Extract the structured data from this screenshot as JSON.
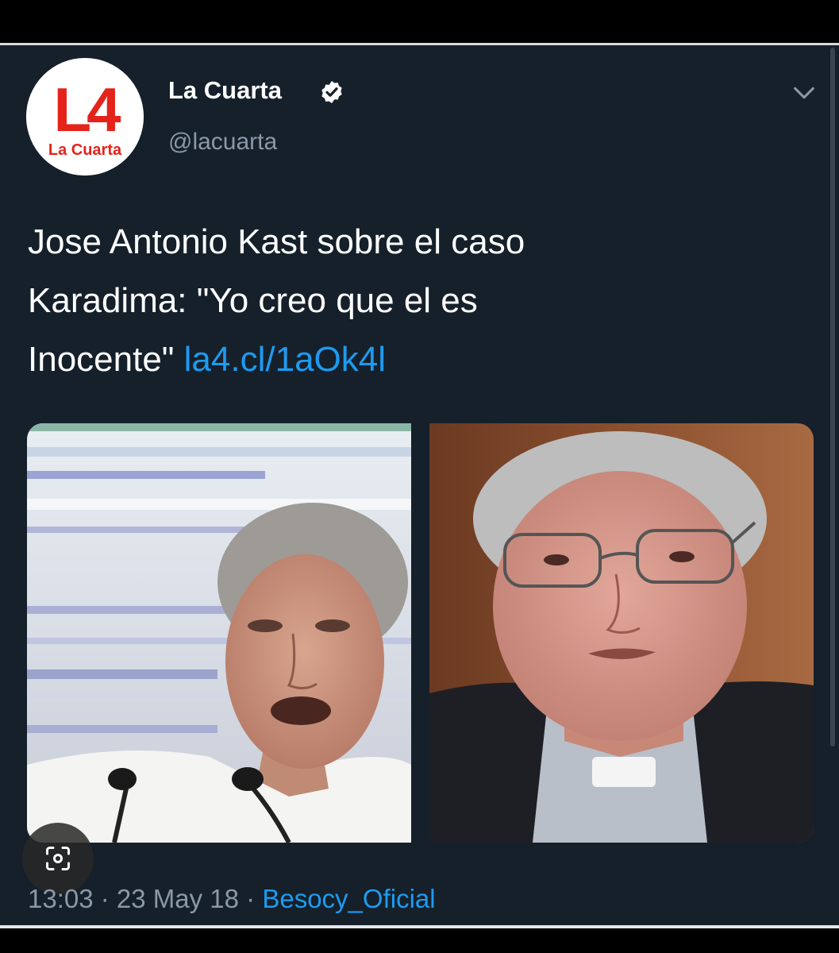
{
  "tweet": {
    "display_name": "La Cuarta",
    "handle": "@lacuarta",
    "avatar": {
      "logo_text": "L4",
      "logo_caption": "La Cuarta",
      "brand_color": "#e4231b"
    },
    "verified_icon": "verified-badge-icon",
    "menu_icon": "chevron-down-icon",
    "text_lines": [
      "Jose Antonio Kast sobre el caso",
      "Karadima: \"Yo creo que el es",
      "Inocente\" "
    ],
    "link": "la4.cl/1aOk4l",
    "footer": {
      "time": "13:03",
      "separator": " · ",
      "date": "23 May 18",
      "source": "Besocy_Oficial"
    },
    "lens_icon": "lens-search-icon"
  },
  "colors": {
    "background": "#15202b",
    "text": "#ffffff",
    "muted": "#8b98a5",
    "link": "#1d9bf0"
  }
}
